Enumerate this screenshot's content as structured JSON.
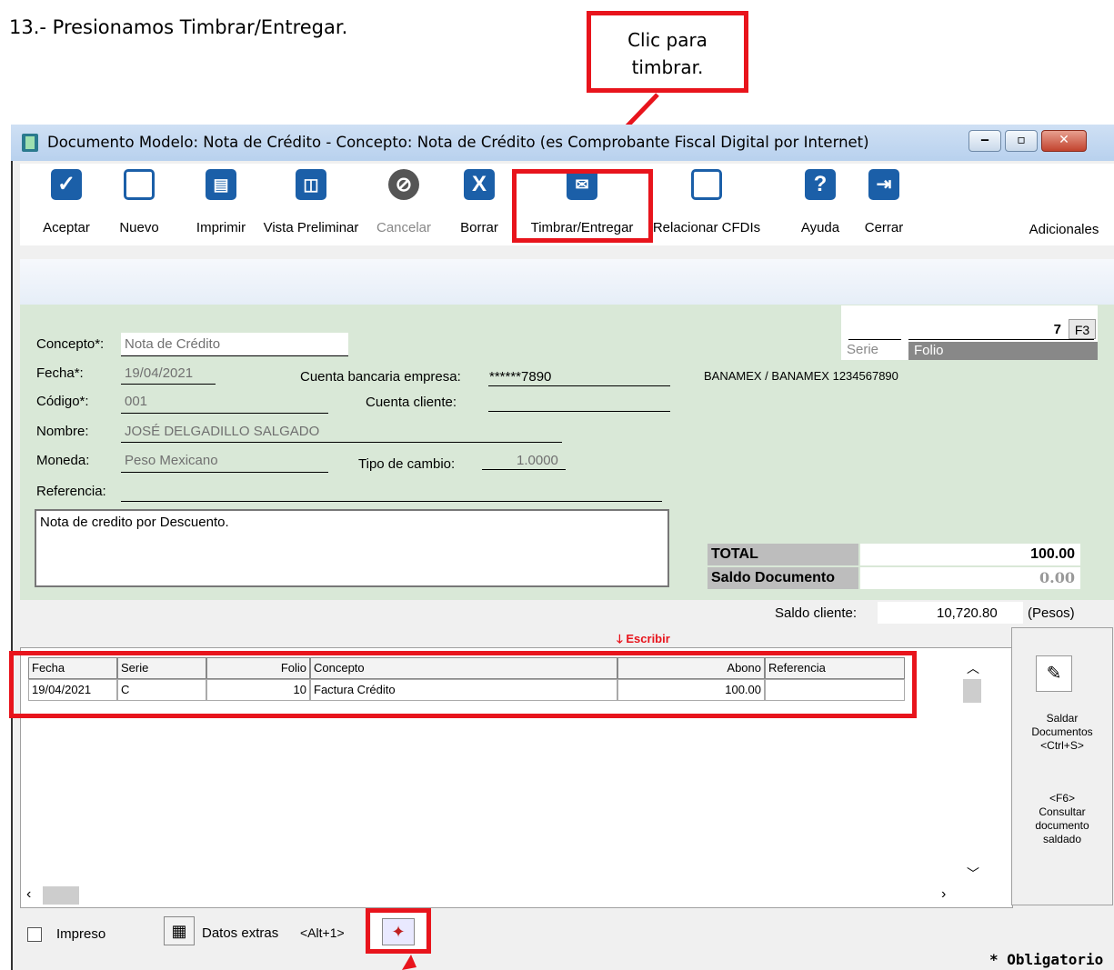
{
  "instruction": "13.- Presionamos Timbrar/Entregar.",
  "callout": {
    "line1": "Clic para",
    "line2": "timbrar."
  },
  "window": {
    "title": "Documento Modelo: Nota de Crédito - Concepto: Nota de Crédito (es Comprobante Fiscal Digital por Internet)",
    "controls": [
      "‒",
      "▫",
      "✕"
    ]
  },
  "toolbar": {
    "items": [
      {
        "label": "Aceptar",
        "icon": "check-icon"
      },
      {
        "label": "Nuevo",
        "icon": "new-doc-icon"
      },
      {
        "label": "Imprimir",
        "icon": "printer-icon"
      },
      {
        "label": "Vista Preliminar",
        "icon": "preview-icon"
      },
      {
        "label": "Cancelar",
        "icon": "cancel-icon"
      },
      {
        "label": "Borrar",
        "icon": "delete-icon"
      },
      {
        "label": "Timbrar/Entregar",
        "icon": "stamp-deliver-icon"
      },
      {
        "label": "Relacionar CFDIs",
        "icon": "relate-icon"
      },
      {
        "label": "Ayuda",
        "icon": "help-icon"
      },
      {
        "label": "Cerrar",
        "icon": "exit-icon"
      }
    ],
    "adicionales": "Adicionales"
  },
  "form": {
    "concepto_label": "Concepto*:",
    "concepto_value": "Nota de Crédito",
    "fecha_label": "Fecha*:",
    "fecha_value": "19/04/2021",
    "cuenta_bancaria_label": "Cuenta bancaria empresa:",
    "cuenta_bancaria_value": "******7890",
    "banco_text": "BANAMEX / BANAMEX 1234567890",
    "codigo_label": "Código*:",
    "codigo_value": "001",
    "cuenta_cliente_label": "Cuenta cliente:",
    "nombre_label": "Nombre:",
    "nombre_value": "JOSÉ DELGADILLO SALGADO",
    "moneda_label": "Moneda:",
    "moneda_value": "Peso Mexicano",
    "tipo_cambio_label": "Tipo de cambio:",
    "tipo_cambio_value": "1.0000",
    "referencia_label": "Referencia:",
    "memo": "Nota de credito por Descuento."
  },
  "folio": {
    "value": "7",
    "key": "F3",
    "serie_label": "Serie",
    "folio_label": "Folio"
  },
  "totals": {
    "total_label": "TOTAL",
    "total_value": "100.00",
    "saldo_doc_label": "Saldo Documento",
    "saldo_doc_value": "0.00",
    "saldo_cliente_label": "Saldo cliente:",
    "saldo_cliente_value": "10,720.80",
    "saldo_cliente_currency": "(Pesos)"
  },
  "grid": {
    "hint": "Escribir",
    "headers": [
      "Fecha",
      "Serie",
      "Folio",
      "Concepto",
      "Abono",
      "Referencia"
    ],
    "rows": [
      [
        "19/04/2021",
        "C",
        "10",
        "Factura Crédito",
        "100.00",
        ""
      ]
    ]
  },
  "side": {
    "saldar_line1": "Saldar",
    "saldar_line2": "Documentos",
    "saldar_line3": "<Ctrl+S>",
    "consultar_line1": "<F6>",
    "consultar_line2": "Consultar",
    "consultar_line3": "documento",
    "consultar_line4": "saldado"
  },
  "footer": {
    "impreso": "Impreso",
    "datos_extras": "Datos extras",
    "datos_shortcut": "<Alt+1>",
    "obligatorio": "* Obligatorio"
  },
  "colors": {
    "highlight": "#e8141c",
    "form_bg": "#d9e8d7",
    "icon_blue": "#1b5fa8"
  }
}
